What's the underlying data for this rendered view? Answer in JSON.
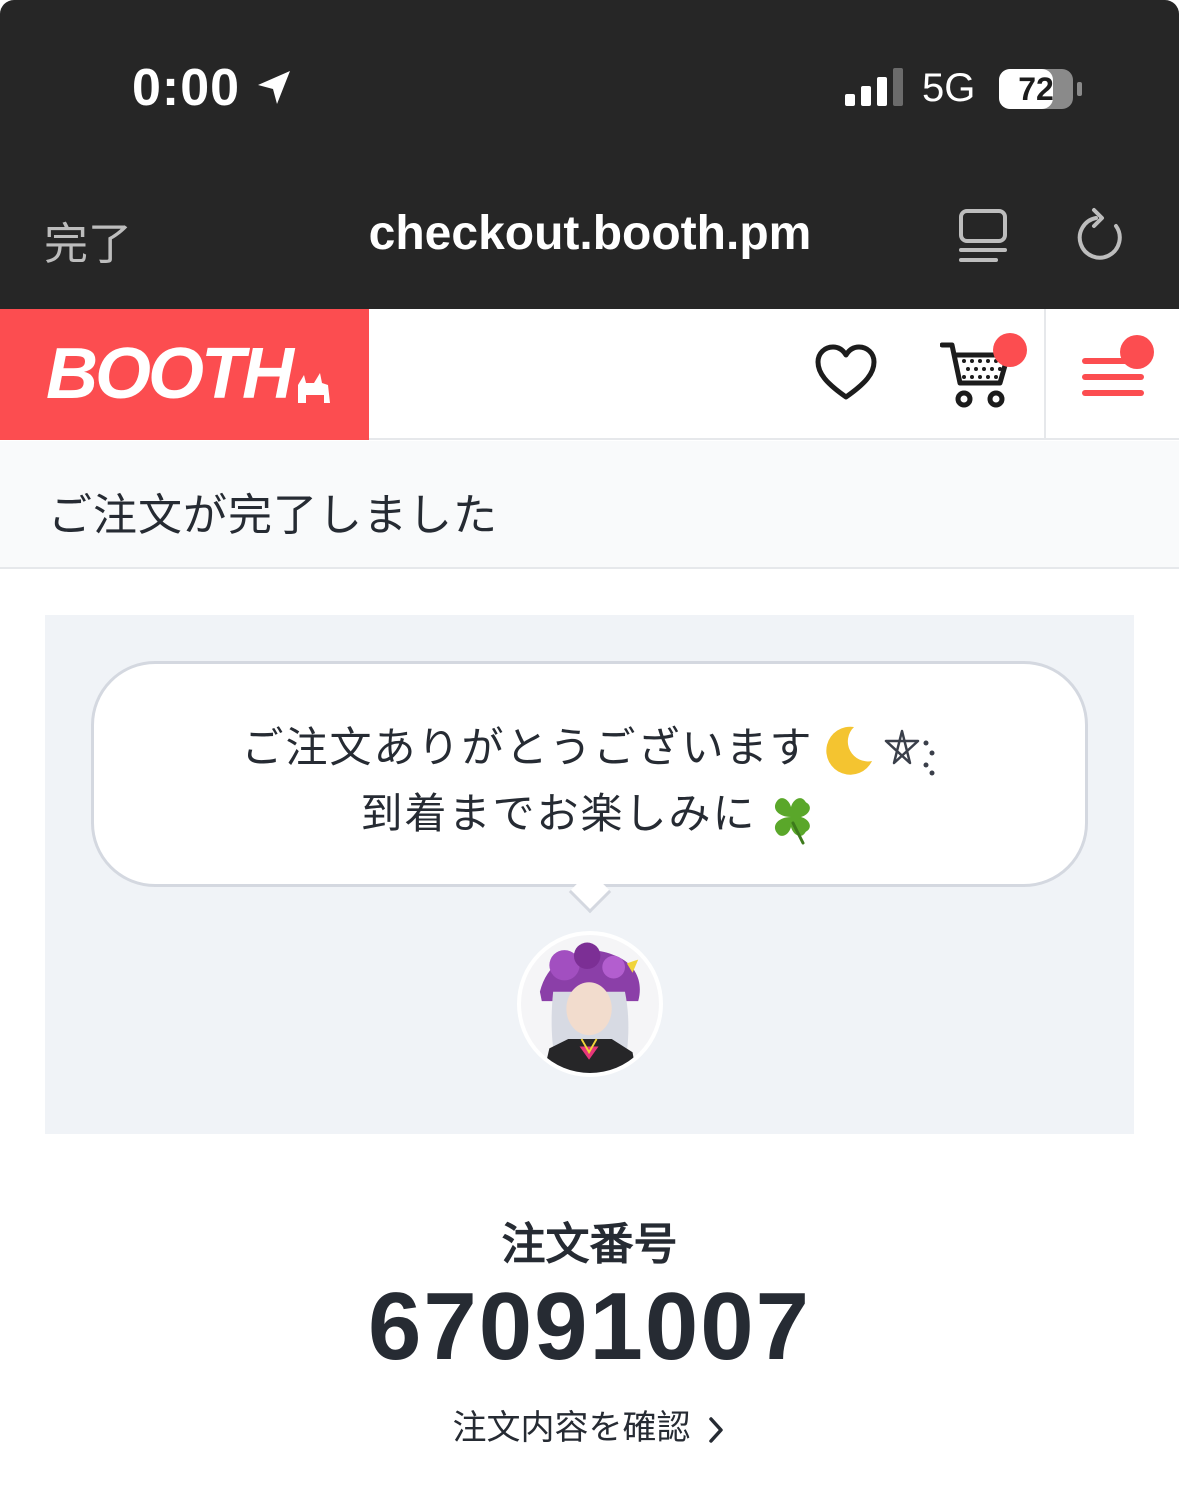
{
  "status_bar": {
    "time": "0:00",
    "network": "5G",
    "battery": "72",
    "battery_level": 0.72
  },
  "browser": {
    "done_label": "完了",
    "url": "checkout.booth.pm"
  },
  "header": {
    "logo_text": "BOOTH",
    "brand_color": "#fc4d50"
  },
  "page": {
    "title": "ご注文が完了しました"
  },
  "message": {
    "line1": "ご注文ありがとうございます",
    "line2": "到着までお楽しみに"
  },
  "order": {
    "label": "注文番号",
    "number": "67091007",
    "link_label": "注文内容を確認"
  }
}
